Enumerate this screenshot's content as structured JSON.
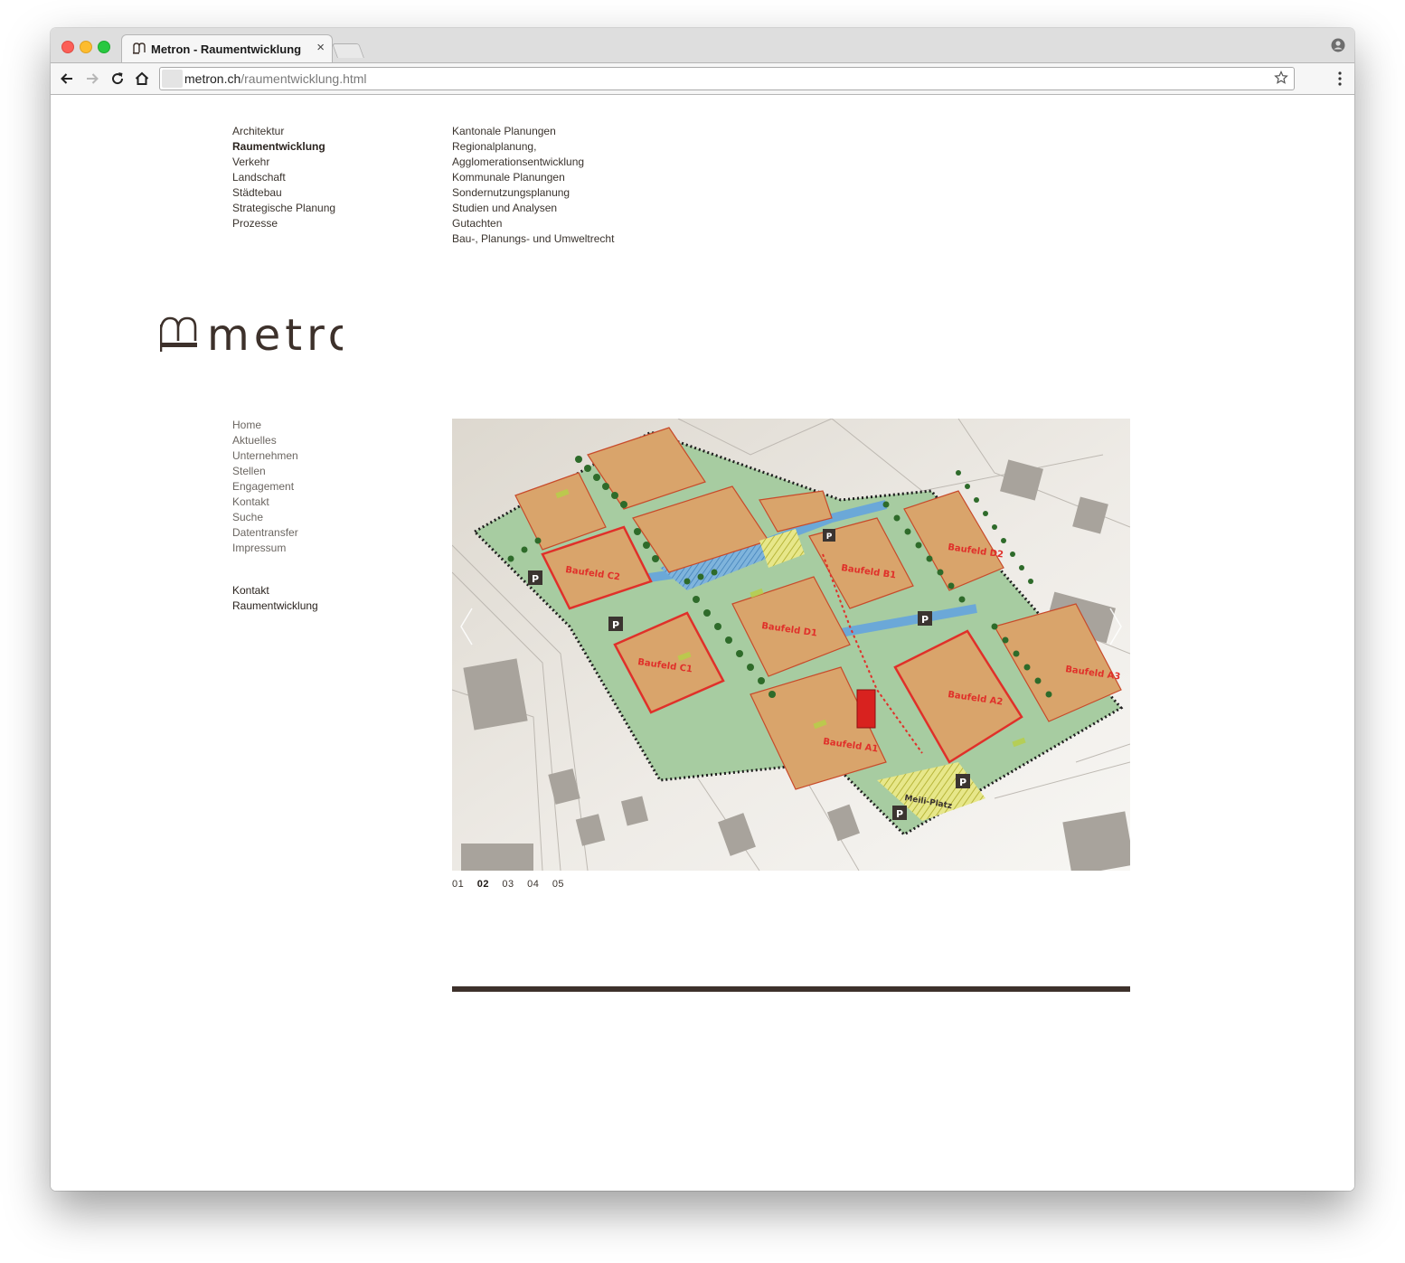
{
  "browser": {
    "tab_title": "Metron - Raumentwicklung",
    "url_host": "metron.ch",
    "url_path": "/raumentwicklung.html",
    "icons": [
      "back-icon",
      "forward-icon",
      "reload-icon",
      "home-icon",
      "bookmark-star-icon",
      "profile-icon",
      "menu-icon",
      "close-icon"
    ]
  },
  "nav": {
    "sections": [
      {
        "label": "Architektur"
      },
      {
        "label": "Raumentwicklung",
        "active": true
      },
      {
        "label": "Verkehr"
      },
      {
        "label": "Landschaft"
      },
      {
        "label": "Städtebau"
      },
      {
        "label": "Strategische Planung"
      },
      {
        "label": "Prozesse"
      }
    ],
    "subsections": [
      {
        "label": "Kantonale Planungen"
      },
      {
        "label": "Regionalplanung,"
      },
      {
        "label": "Agglomerationsentwicklung"
      },
      {
        "label": "Kommunale Planungen"
      },
      {
        "label": "Sondernutzungsplanung"
      },
      {
        "label": "Studien und Analysen"
      },
      {
        "label": "Gutachten"
      },
      {
        "label": "Bau-, Planungs- und Umweltrecht"
      }
    ],
    "meta": [
      {
        "label": "Home"
      },
      {
        "label": "Aktuelles"
      },
      {
        "label": "Unternehmen"
      },
      {
        "label": "Stellen"
      },
      {
        "label": "Engagement"
      },
      {
        "label": "Kontakt"
      },
      {
        "label": "Suche"
      },
      {
        "label": "Datentransfer"
      },
      {
        "label": "Impressum"
      }
    ],
    "contact": [
      {
        "label": "Kontakt"
      },
      {
        "label": "Raumentwicklung"
      }
    ]
  },
  "logo": {
    "text": "metron"
  },
  "slider": {
    "image_labels": {
      "baufeld_a1": "Baufeld A1",
      "baufeld_a2": "Baufeld A2",
      "baufeld_a3": "Baufeld A3",
      "baufeld_b1": "Baufeld B1",
      "baufeld_c1": "Baufeld C1",
      "baufeld_c2": "Baufeld C2",
      "baufeld_d1": "Baufeld D1",
      "baufeld_d2": "Baufeld D2",
      "platz": "Meili-Platz",
      "parking": "P"
    },
    "pages": [
      "01",
      "02",
      "03",
      "04",
      "05"
    ],
    "current_page": "02"
  },
  "colors": {
    "brand_dark": "#3d312b",
    "text": "#3a332d",
    "plan_orange": "#d9a46b",
    "plan_green": "#9fc79a",
    "plan_red": "#e0302a",
    "plan_blue": "#6ba8d8"
  }
}
